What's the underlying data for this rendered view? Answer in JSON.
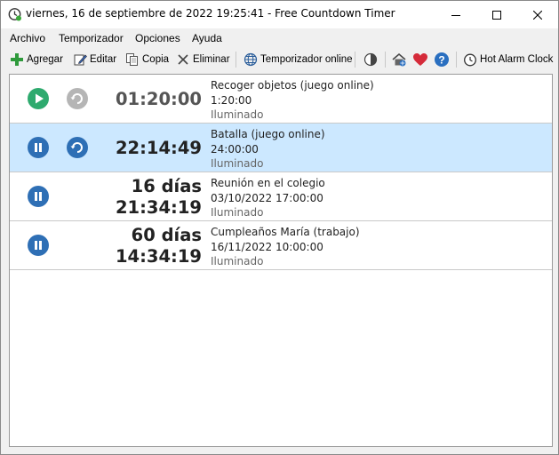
{
  "window": {
    "title": "viernes, 16 de septiembre de 2022 19:25:41 - Free Countdown Timer",
    "controls": [
      "minimize-icon",
      "maximize-icon",
      "close-icon"
    ]
  },
  "menu": {
    "items": [
      "Archivo",
      "Temporizador",
      "Opciones",
      "Ayuda"
    ]
  },
  "toolbar": {
    "add_label": "Agregar",
    "edit_label": "Editar",
    "copy_label": "Copia",
    "delete_label": "Eliminar",
    "online_label": "Temporizador online",
    "hot_alarm_label": "Hot Alarm Clock",
    "icons": [
      "plus-icon",
      "edit-icon",
      "copy-icon",
      "delete-icon",
      "globe-icon",
      "contrast-icon",
      "home-icon",
      "heart-icon",
      "help-icon",
      "clock-icon"
    ]
  },
  "colors": {
    "play_green": "#2eaa6e",
    "pause_blue": "#2e6fb5",
    "selected_row": "#cce8ff",
    "heart_red": "#d52b3a"
  },
  "timers": [
    {
      "state": "stopped",
      "time_line1": "01:20:00",
      "time_line2": "",
      "name": "Recoger objetos (juego online)",
      "target": "1:20:00",
      "theme": "Iluminado",
      "selected": false
    },
    {
      "state": "running",
      "time_line1": "22:14:49",
      "time_line2": "",
      "name": "Batalla (juego online)",
      "target": "24:00:00",
      "theme": "Iluminado",
      "selected": true
    },
    {
      "state": "running",
      "time_line1": "16 días",
      "time_line2": "21:34:19",
      "name": "Reunión en el colegio",
      "target": "03/10/2022 17:00:00",
      "theme": "Iluminado",
      "selected": false
    },
    {
      "state": "running",
      "time_line1": "60 días",
      "time_line2": "14:34:19",
      "name": "Cumpleaños María (trabajo)",
      "target": "16/11/2022 10:00:00",
      "theme": "Iluminado",
      "selected": false
    }
  ]
}
